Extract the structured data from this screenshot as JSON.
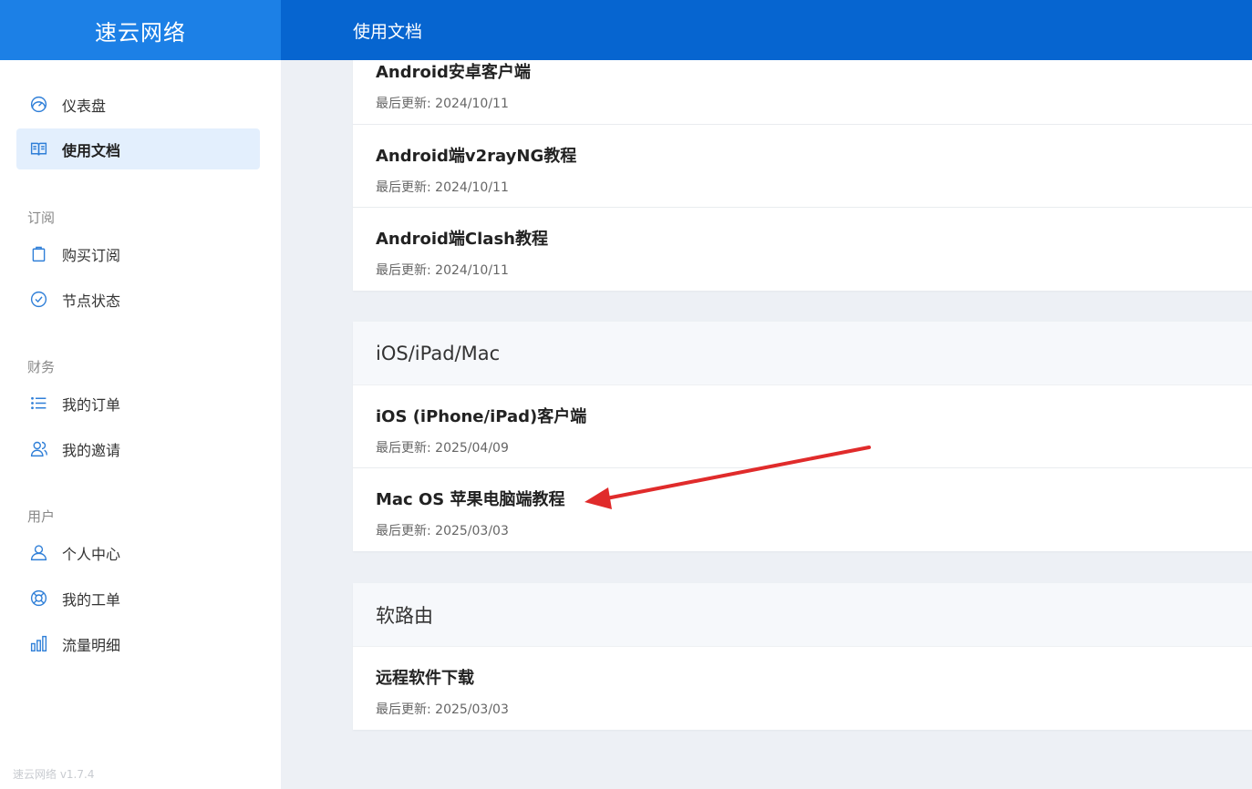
{
  "app": {
    "brand": "速云网络",
    "page_title": "使用文档",
    "version": "速云网络 v1.7.4"
  },
  "sidebar": {
    "items": [
      {
        "label": "仪表盘",
        "icon": "dashboard-icon"
      },
      {
        "label": "使用文档",
        "icon": "book-icon",
        "active": true
      }
    ],
    "sections": [
      {
        "title": "订阅",
        "items": [
          {
            "label": "购买订阅",
            "icon": "shopping-bag-icon"
          },
          {
            "label": "节点状态",
            "icon": "check-circle-icon"
          }
        ]
      },
      {
        "title": "财务",
        "items": [
          {
            "label": "我的订单",
            "icon": "list-icon"
          },
          {
            "label": "我的邀请",
            "icon": "users-icon"
          }
        ]
      },
      {
        "title": "用户",
        "items": [
          {
            "label": "个人中心",
            "icon": "user-icon"
          },
          {
            "label": "我的工单",
            "icon": "lifebuoy-icon"
          },
          {
            "label": "流量明细",
            "icon": "bar-chart-icon"
          }
        ]
      }
    ]
  },
  "docs": {
    "groups": [
      {
        "title": "",
        "items": [
          {
            "title": "Android安卓客户端",
            "date": "最后更新: 2024/10/11"
          },
          {
            "title": "Android端v2rayNG教程",
            "date": "最后更新: 2024/10/11"
          },
          {
            "title": "Android端Clash教程",
            "date": "最后更新: 2024/10/11"
          }
        ]
      },
      {
        "title": "iOS/iPad/Mac",
        "items": [
          {
            "title": "iOS (iPhone/iPad)客户端",
            "date": "最后更新: 2025/04/09"
          },
          {
            "title": "Mac OS 苹果电脑端教程",
            "date": "最后更新: 2025/03/03"
          }
        ]
      },
      {
        "title": "软路由",
        "items": [
          {
            "title": "远程软件下载",
            "date": "最后更新: 2025/03/03"
          }
        ]
      }
    ]
  },
  "colors": {
    "brand_bg": "#1c80e6",
    "topbar_bg": "#0665d0",
    "accent": "#2f7fd8",
    "annotation_arrow": "#e02b2b"
  }
}
